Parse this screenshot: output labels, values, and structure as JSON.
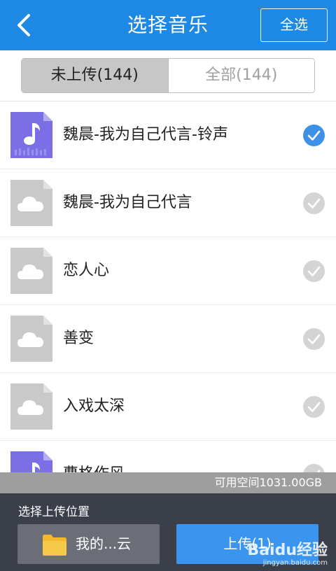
{
  "header": {
    "title": "选择音乐",
    "select_all_label": "全选"
  },
  "tabs": [
    {
      "label": "未上传(144)",
      "active": true
    },
    {
      "label": "全部(144)",
      "active": false
    }
  ],
  "songs": [
    {
      "name": "魏晨-我为自己代言-铃声",
      "icon": "music-file-icon",
      "checked": true
    },
    {
      "name": "魏晨-我为自己代言",
      "icon": "cloud-file-icon",
      "checked": false
    },
    {
      "name": "恋人心",
      "icon": "cloud-file-icon",
      "checked": false
    },
    {
      "name": "善变",
      "icon": "cloud-file-icon",
      "checked": false
    },
    {
      "name": "入戏太深",
      "icon": "cloud-file-icon",
      "checked": false
    },
    {
      "name": "曹格作风",
      "icon": "music-file-icon",
      "checked": false
    }
  ],
  "storage": {
    "available_text": "可用空间1031.00GB"
  },
  "footer": {
    "location_label": "选择上传位置",
    "location_button": "我的...云",
    "upload_button": "上传(1)"
  },
  "watermark": {
    "brand": "Baidu经验",
    "url": "jingyan.baidu.com"
  },
  "colors": {
    "header_bg": "#1e88e5",
    "music_icon": "#7c6fe6",
    "cloud_icon": "#c9c9c9",
    "check_on": "#3d92e8",
    "footer_bg": "#3a3f4a",
    "upload_button": "#3b94ee"
  }
}
